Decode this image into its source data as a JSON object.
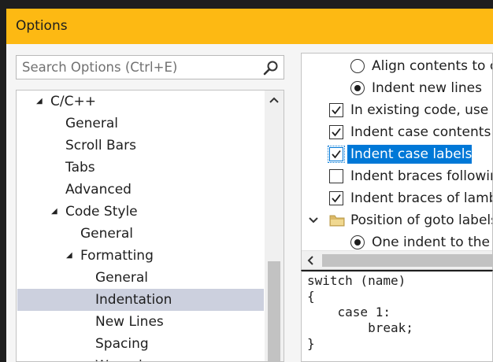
{
  "window": {
    "title": "Options"
  },
  "search": {
    "placeholder": "Search Options (Ctrl+E)"
  },
  "tree": {
    "items": [
      {
        "label": "C/C++",
        "expanded": true
      },
      {
        "label": "General"
      },
      {
        "label": "Scroll Bars"
      },
      {
        "label": "Tabs"
      },
      {
        "label": "Advanced"
      },
      {
        "label": "Code Style",
        "expanded": true
      },
      {
        "label": "General"
      },
      {
        "label": "Formatting",
        "expanded": true
      },
      {
        "label": "General"
      },
      {
        "label": "Indentation",
        "selected": true
      },
      {
        "label": "New Lines"
      },
      {
        "label": "Spacing"
      },
      {
        "label": "Wrapping"
      }
    ]
  },
  "settings": {
    "items": [
      {
        "type": "radio",
        "checked": false,
        "label": "Align contents to c"
      },
      {
        "type": "radio",
        "checked": true,
        "label": "Indent new lines"
      },
      {
        "type": "checkbox",
        "checked": true,
        "label": "In existing code, use th"
      },
      {
        "type": "checkbox",
        "checked": true,
        "label": "Indent case contents"
      },
      {
        "type": "checkbox",
        "checked": true,
        "label": "Indent case labels",
        "selected": true
      },
      {
        "type": "checkbox",
        "checked": false,
        "label": "Indent braces followin"
      },
      {
        "type": "checkbox",
        "checked": true,
        "label": "Indent braces of lamb"
      },
      {
        "type": "group",
        "label": "Position of goto labels"
      },
      {
        "type": "radio",
        "checked": true,
        "label": "One indent to the l"
      }
    ]
  },
  "preview": {
    "lines": [
      "switch (name)",
      "{",
      "    case 1:",
      "        break;",
      "}"
    ]
  },
  "colors": {
    "titlebar": "#fdb913",
    "selection": "#0078d7",
    "tree_selection": "#ccd0de"
  }
}
